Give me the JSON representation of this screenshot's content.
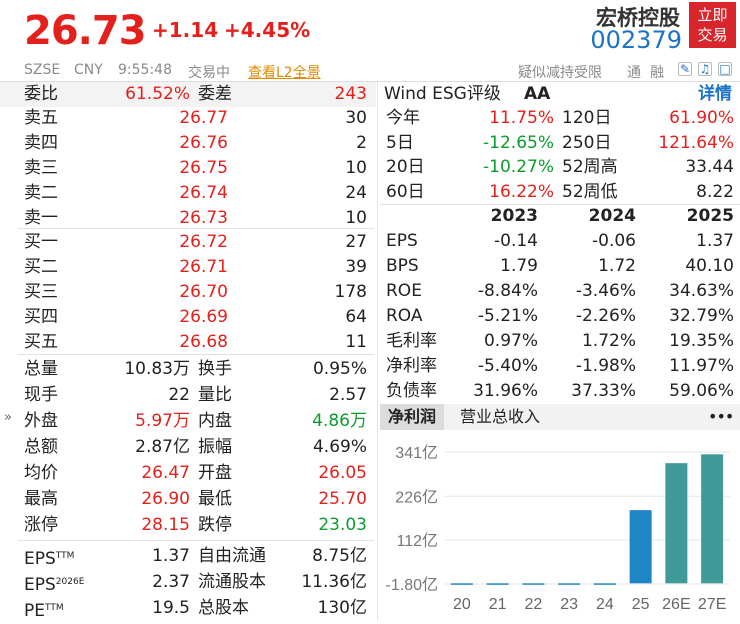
{
  "header": {
    "price": "26.73",
    "change": "+1.14",
    "change_pct": "+4.45%",
    "name": "宏桥控股",
    "code": "002379",
    "trade_btn_line1": "立即",
    "trade_btn_line2": "交易",
    "market": "SZSE",
    "currency": "CNY",
    "time": "9:55:48",
    "status": "交易中",
    "l2_link": "查看L2全景",
    "notice": "疑似减持受限",
    "tag1": "通",
    "tag2": "融"
  },
  "book": {
    "webi_label": "委比",
    "webi_value": "61.52%",
    "weicha_label": "委差",
    "weicha_value": "243",
    "asks": [
      {
        "label": "卖五",
        "price": "26.77",
        "vol": "30"
      },
      {
        "label": "卖四",
        "price": "26.76",
        "vol": "2"
      },
      {
        "label": "卖三",
        "price": "26.75",
        "vol": "10"
      },
      {
        "label": "卖二",
        "price": "26.74",
        "vol": "24"
      },
      {
        "label": "卖一",
        "price": "26.73",
        "vol": "10"
      }
    ],
    "bids": [
      {
        "label": "买一",
        "price": "26.72",
        "vol": "27"
      },
      {
        "label": "买二",
        "price": "26.71",
        "vol": "39"
      },
      {
        "label": "买三",
        "price": "26.70",
        "vol": "178"
      },
      {
        "label": "买四",
        "price": "26.69",
        "vol": "64"
      },
      {
        "label": "买五",
        "price": "26.68",
        "vol": "11"
      }
    ]
  },
  "stats": [
    {
      "l1": "总量",
      "v1": "10.83万",
      "c1": "d",
      "l2": "换手",
      "v2": "0.95%",
      "c2": "d"
    },
    {
      "l1": "现手",
      "v1": "22",
      "c1": "d",
      "l2": "量比",
      "v2": "2.57",
      "c2": "d"
    },
    {
      "l1": "外盘",
      "v1": "5.97万",
      "c1": "r",
      "l2": "内盘",
      "v2": "4.86万",
      "c2": "g"
    },
    {
      "l1": "总额",
      "v1": "2.87亿",
      "c1": "d",
      "l2": "振幅",
      "v2": "4.69%",
      "c2": "d"
    },
    {
      "l1": "均价",
      "v1": "26.47",
      "c1": "r",
      "l2": "开盘",
      "v2": "26.05",
      "c2": "r"
    },
    {
      "l1": "最高",
      "v1": "26.90",
      "c1": "r",
      "l2": "最低",
      "v2": "25.70",
      "c2": "r"
    },
    {
      "l1": "涨停",
      "v1": "28.15",
      "c1": "r",
      "l2": "跌停",
      "v2": "23.03",
      "c2": "g"
    }
  ],
  "fund": [
    {
      "l1": "EPS",
      "s1": "TTM",
      "v1": "1.37",
      "l2": "自由流通",
      "v2": "8.75亿"
    },
    {
      "l1": "EPS",
      "s1": "2026E",
      "v1": "2.37",
      "l2": "流通股本",
      "v2": "11.36亿"
    },
    {
      "l1": "PE",
      "s1": "TTM",
      "v1": "19.5",
      "l2": "总股本",
      "v2": "130亿"
    }
  ],
  "esg": {
    "label": "Wind ESG评级",
    "rating": "AA",
    "detail": "详情"
  },
  "perf": [
    {
      "l1": "今年",
      "v1": "11.75%",
      "c1": "r",
      "l2": "120日",
      "v2": "61.90%",
      "c2": "r"
    },
    {
      "l1": "5日",
      "v1": "-12.65%",
      "c1": "g",
      "l2": "250日",
      "v2": "121.64%",
      "c2": "r"
    },
    {
      "l1": "20日",
      "v1": "-10.27%",
      "c1": "g",
      "l2": "52周高",
      "v2": "33.44",
      "c2": "d"
    },
    {
      "l1": "60日",
      "v1": "16.22%",
      "c1": "r",
      "l2": "52周低",
      "v2": "8.22",
      "c2": "d"
    }
  ],
  "fin": {
    "years": [
      "2023",
      "2024",
      "2025"
    ],
    "rows": [
      {
        "label": "EPS",
        "vals": [
          "-0.14",
          "-0.06",
          "1.37"
        ]
      },
      {
        "label": "BPS",
        "vals": [
          "1.79",
          "1.72",
          "40.10"
        ]
      },
      {
        "label": "ROE",
        "vals": [
          "-8.84%",
          "-3.46%",
          "34.63%"
        ]
      },
      {
        "label": "ROA",
        "vals": [
          "-5.21%",
          "-2.26%",
          "32.79%"
        ]
      },
      {
        "label": "毛利率",
        "vals": [
          "0.97%",
          "1.72%",
          "19.35%"
        ]
      },
      {
        "label": "净利率",
        "vals": [
          "-5.40%",
          "-1.98%",
          "11.97%"
        ]
      },
      {
        "label": "负债率",
        "vals": [
          "31.96%",
          "37.33%",
          "59.06%"
        ]
      }
    ]
  },
  "tabs": {
    "t1": "净利润",
    "t2": "营业总收入",
    "more": "•••"
  },
  "expand_arrow": "»",
  "chart_data": {
    "type": "bar",
    "categories": [
      "20",
      "21",
      "22",
      "23",
      "24",
      "25",
      "26E",
      "27E"
    ],
    "values": [
      -1.8,
      -1.8,
      -1.8,
      -1.8,
      -1.8,
      190,
      312,
      335
    ],
    "yticks": [
      "341亿",
      "226亿",
      "112亿",
      "-1.80亿"
    ],
    "ylim": [
      -1.8,
      341
    ],
    "colors": {
      "actual": "#1f86c6",
      "forecast": "#3f9a99"
    }
  }
}
